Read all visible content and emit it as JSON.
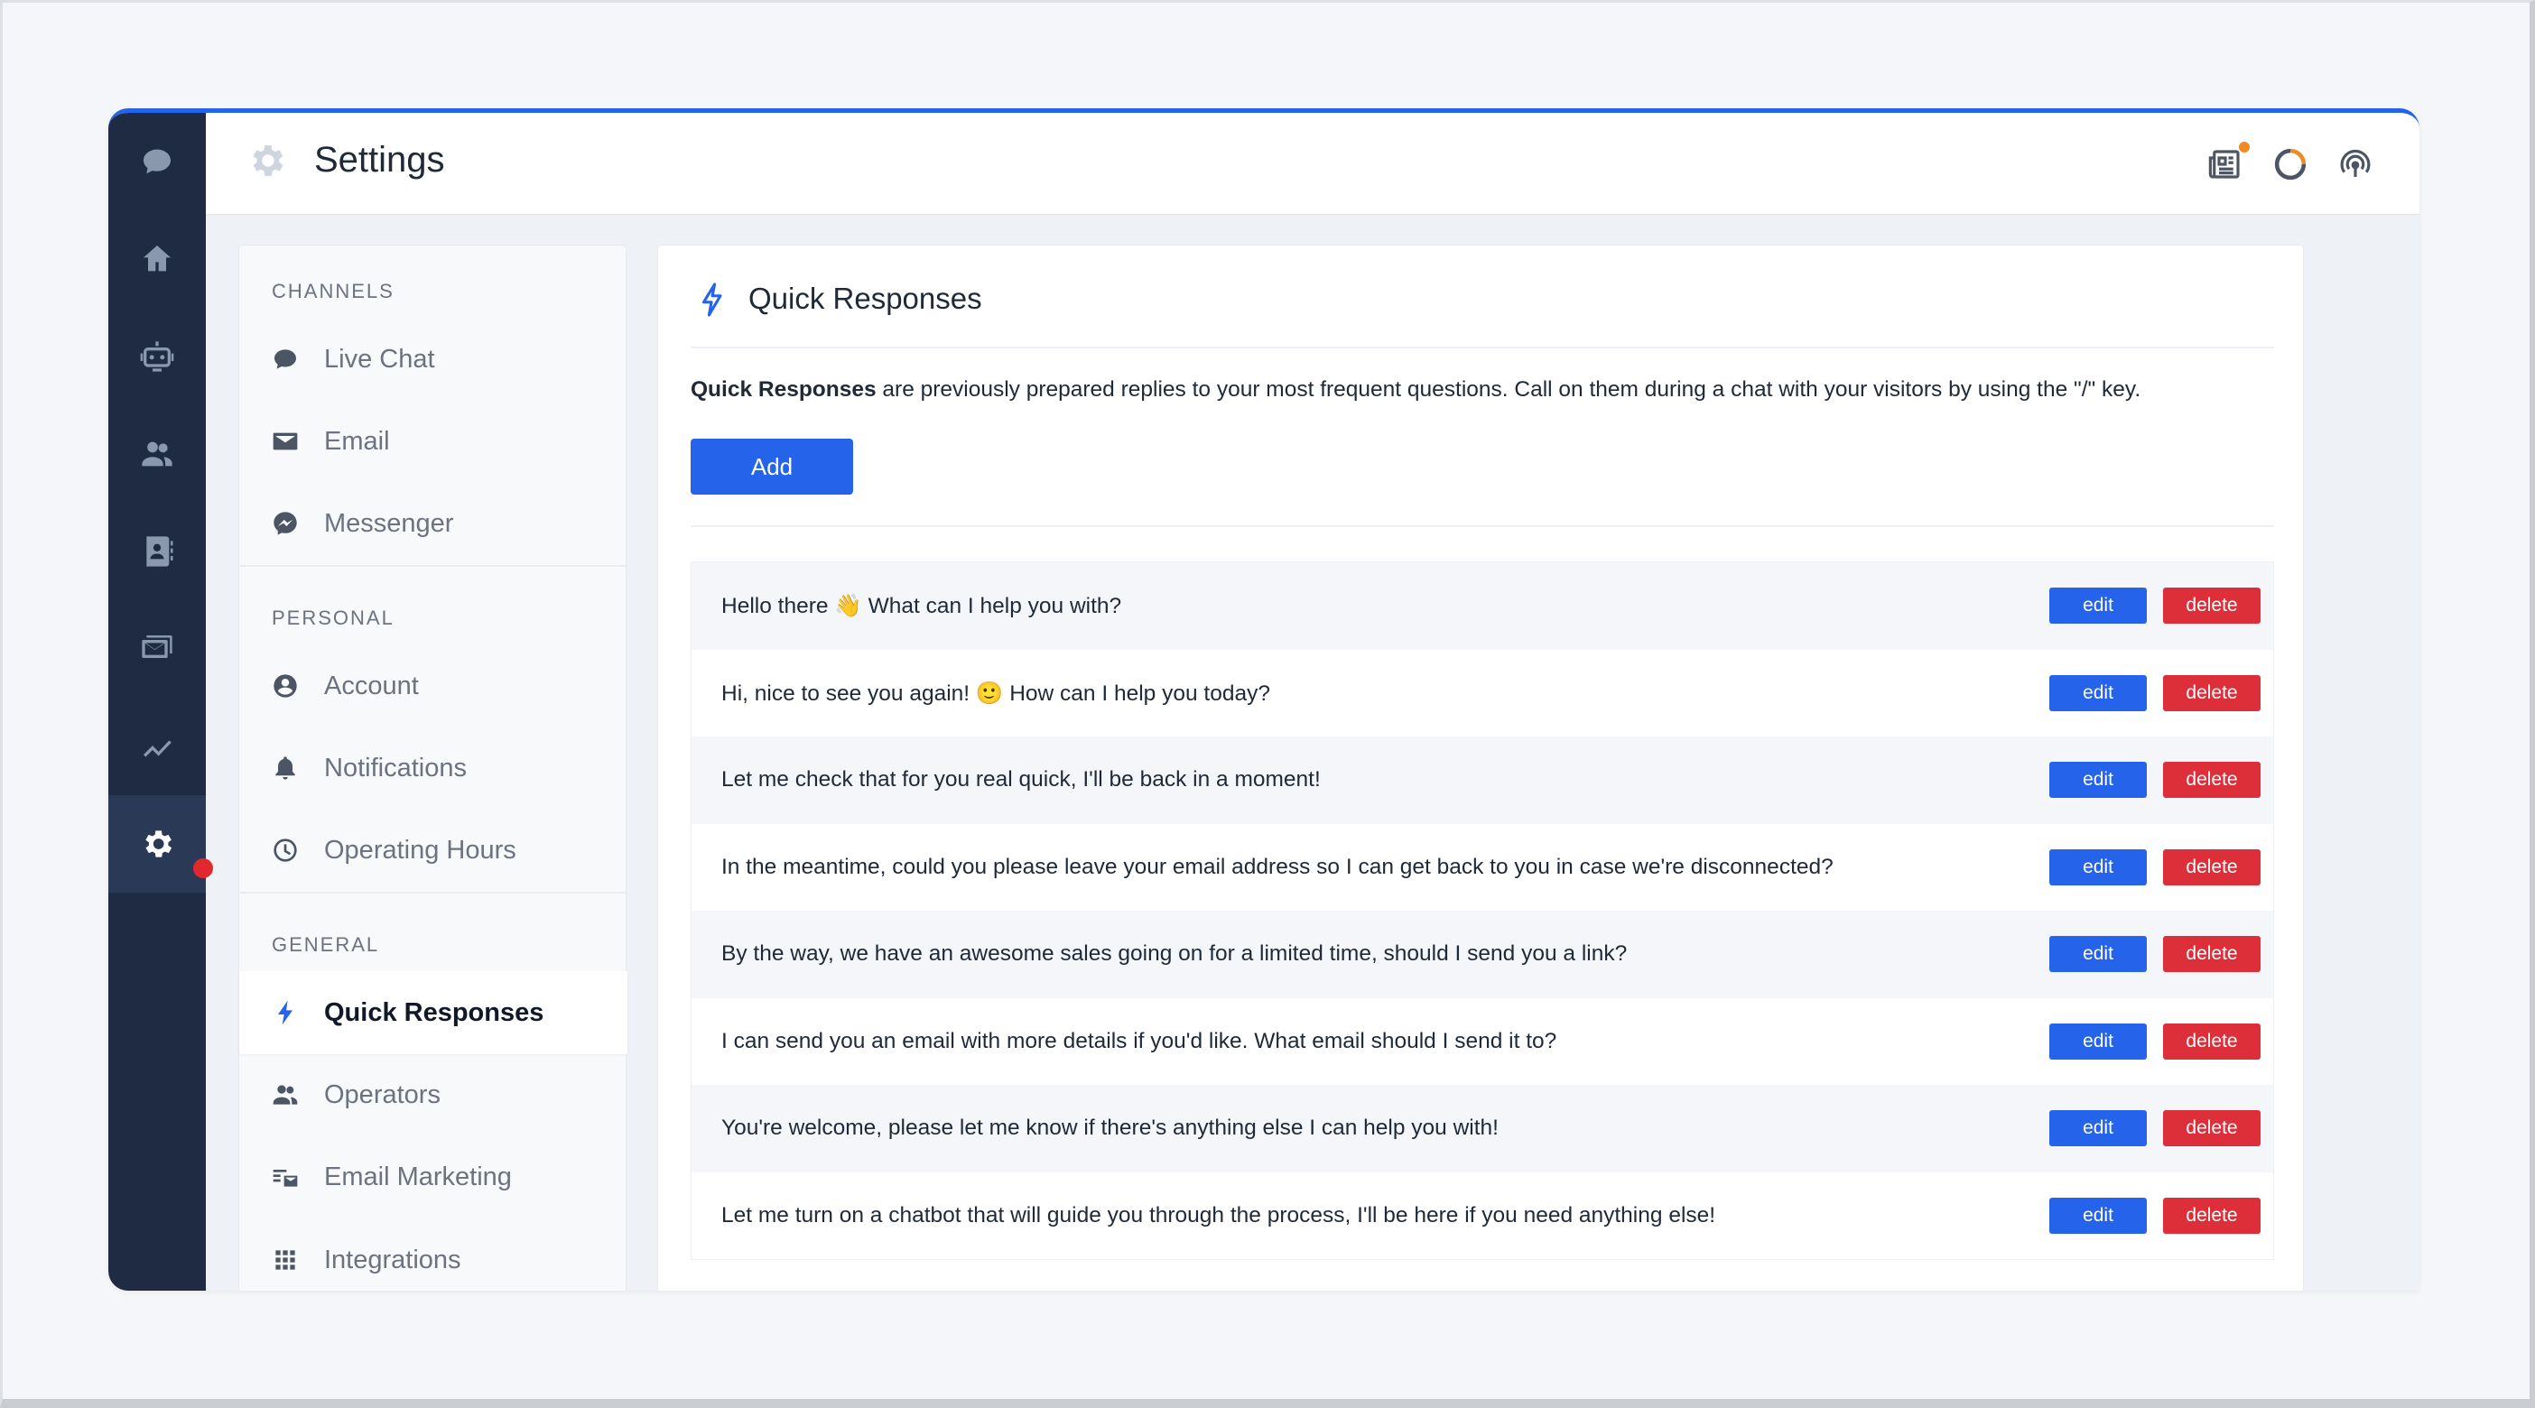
{
  "header": {
    "title": "Settings"
  },
  "rail": {
    "items": [
      "chat-icon",
      "home-icon",
      "bot-icon",
      "users-icon",
      "contacts-icon",
      "inbox-icon",
      "analytics-icon",
      "gear-icon"
    ],
    "active": "gear-icon"
  },
  "subnav": {
    "sections": [
      {
        "heading": "CHANNELS",
        "items": [
          {
            "label": "Live Chat",
            "icon": "chat-bubble-icon"
          },
          {
            "label": "Email",
            "icon": "envelope-icon"
          },
          {
            "label": "Messenger",
            "icon": "messenger-icon"
          }
        ]
      },
      {
        "heading": "PERSONAL",
        "items": [
          {
            "label": "Account",
            "icon": "account-icon"
          },
          {
            "label": "Notifications",
            "icon": "bell-icon"
          },
          {
            "label": "Operating Hours",
            "icon": "clock-icon"
          }
        ]
      },
      {
        "heading": "GENERAL",
        "items": [
          {
            "label": "Quick Responses",
            "icon": "bolt-icon"
          },
          {
            "label": "Operators",
            "icon": "users-icon"
          },
          {
            "label": "Email Marketing",
            "icon": "email-marketing-icon"
          },
          {
            "label": "Integrations",
            "icon": "grid-icon"
          }
        ]
      }
    ],
    "active": "Quick Responses"
  },
  "panel": {
    "title": "Quick Responses",
    "desc_bold": "Quick Responses",
    "desc_rest": " are previously prepared replies to your most frequent questions. Call on them during a chat with your visitors by using the \"/\" key.",
    "add_label": "Add",
    "edit_label": "edit",
    "delete_label": "delete",
    "responses": [
      "Hello there 👋 What can I help you with?",
      "Hi, nice to see you again! 🙂 How can I help you today?",
      "Let me check that for you real quick, I'll be back in a moment!",
      "In the meantime, could you please leave your email address so I can get back to you in case we're disconnected?",
      "By the way, we have an awesome sales going on for a limited time, should I send you a link?",
      "I can send you an email with more details if you'd like. What email should I send it to?",
      "You're welcome, please let me know if there's anything else I can help you with!",
      "Let me turn on a chatbot that will guide you through the process, I'll be here if you need anything else!"
    ]
  },
  "colors": {
    "accent": "#2563eb",
    "danger": "#dc2f3a",
    "rail": "#1e2b42",
    "status_dot": "#e0282e",
    "notif_dot": "#f08a24"
  }
}
